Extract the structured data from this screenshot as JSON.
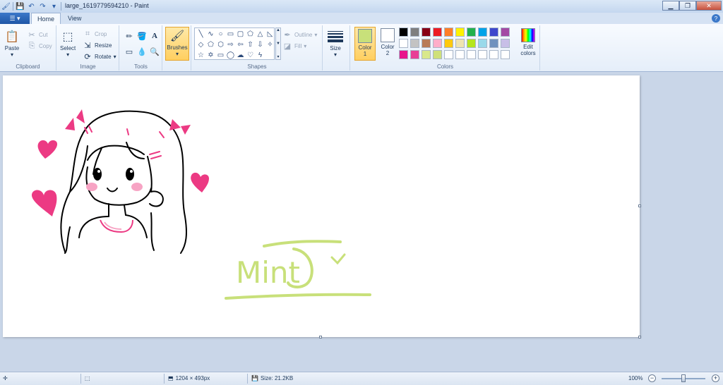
{
  "window": {
    "title": "large_1619779594210 - Paint",
    "minimize_label": "▁",
    "maximize_label": "❐",
    "close_label": "✕"
  },
  "tabs": {
    "file_icon": "☰ ▾",
    "home": "Home",
    "view": "View",
    "help_icon": "?"
  },
  "ribbon": {
    "clipboard": {
      "label": "Clipboard",
      "paste": "Paste",
      "cut": "Cut",
      "copy": "Copy"
    },
    "image": {
      "label": "Image",
      "select": "Select",
      "crop": "Crop",
      "resize": "Resize",
      "rotate": "Rotate"
    },
    "tools": {
      "label": "Tools"
    },
    "brushes": {
      "label": "Brushes"
    },
    "shapes": {
      "label": "Shapes",
      "outline": "Outline",
      "fill": "Fill"
    },
    "size": {
      "label": "Size"
    },
    "colors": {
      "label": "Colors",
      "color1": "Color 1",
      "color2": "Color 2",
      "edit_colors": "Edit colors",
      "color1_value": "#c8e07a",
      "color2_value": "#ffffff",
      "palette": [
        "#000000",
        "#7f7f7f",
        "#880015",
        "#ed1c24",
        "#ff7f27",
        "#fff200",
        "#22b14c",
        "#00a2e8",
        "#3f48cc",
        "#a349a4",
        "#ffffff",
        "#c3c3c3",
        "#b97a57",
        "#ffaec9",
        "#ffc90e",
        "#efe4b0",
        "#b5e61d",
        "#99d9ea",
        "#7092be",
        "#c8bfe7",
        "#e8138c",
        "#e83e96",
        "#d9e88a",
        "#cfe07a",
        "#ffffff",
        "#ffffff",
        "#ffffff",
        "#ffffff",
        "#ffffff",
        "#ffffff"
      ]
    }
  },
  "canvas": {
    "signature_text": "Mint",
    "accent_pink": "#ec3a83",
    "signature_green": "#c8e07a"
  },
  "status": {
    "dimensions": "1204 × 493px",
    "size": "Size: 21.2KB",
    "zoom": "100%"
  }
}
